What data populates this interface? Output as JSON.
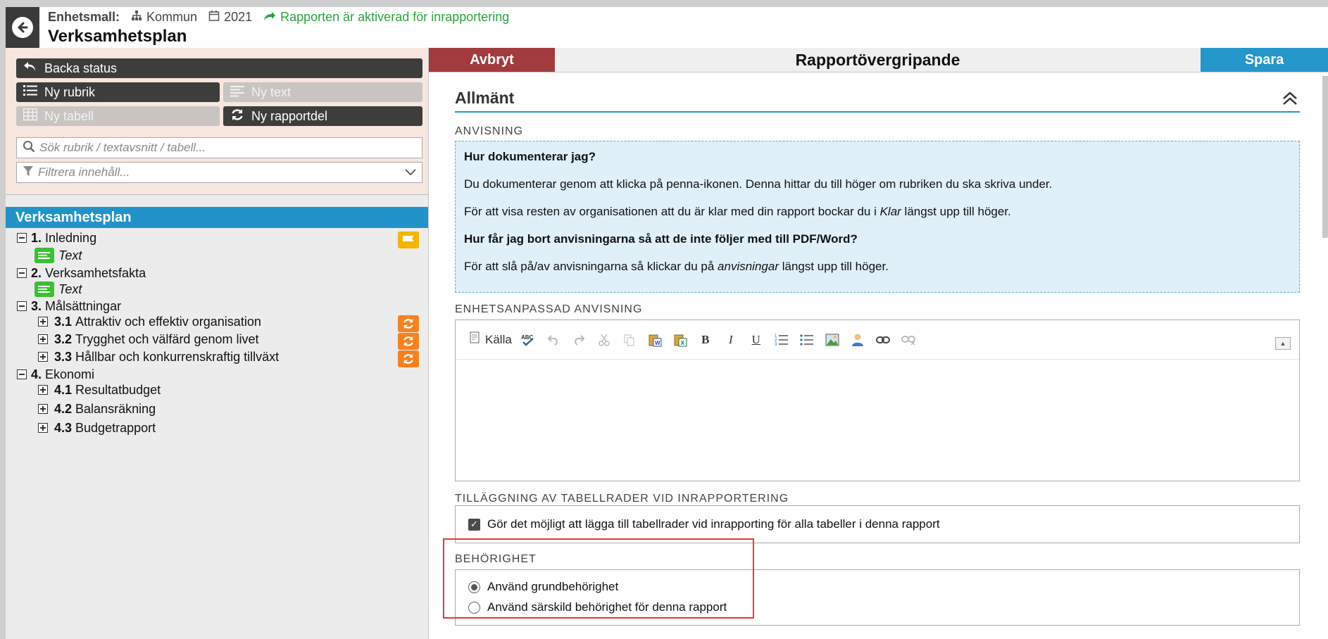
{
  "header": {
    "template_label": "Enhetsmall:",
    "org": "Kommun",
    "year": "2021",
    "status": "Rapporten är aktiverad för inrapportering",
    "title": "Verksamhetsplan"
  },
  "toolbox": {
    "back_status": "Backa status",
    "new_heading": "Ny rubrik",
    "new_text": "Ny text",
    "new_table": "Ny tabell",
    "new_report_part": "Ny rapportdel",
    "search_placeholder": "Sök rubrik / textavsnitt / tabell...",
    "filter_placeholder": "Filtrera innehåll..."
  },
  "tree": {
    "root": "Verksamhetsplan",
    "items": [
      {
        "num": "1.",
        "label": "Inledning"
      },
      {
        "label": "Text"
      },
      {
        "num": "2.",
        "label": "Verksamhetsfakta"
      },
      {
        "label": "Text"
      },
      {
        "num": "3.",
        "label": "Målsättningar"
      },
      {
        "num": "3.1",
        "label": "Attraktiv och effektiv organisation"
      },
      {
        "num": "3.2",
        "label": "Trygghet och välfärd genom livet"
      },
      {
        "num": "3.3",
        "label": "Hållbar och konkurrenskraftig tillväxt"
      },
      {
        "num": "4.",
        "label": "Ekonomi"
      },
      {
        "num": "4.1",
        "label": "Resultatbudget"
      },
      {
        "num": "4.2",
        "label": "Balansräkning"
      },
      {
        "num": "4.3",
        "label": "Budgetrapport"
      }
    ]
  },
  "actions": {
    "cancel": "Avbryt",
    "title": "Rapportövergripande",
    "save": "Spara"
  },
  "section": {
    "title": "Allmänt",
    "anvisning_label": "ANVISNING",
    "q1": "Hur dokumenterar jag?",
    "p1": "Du dokumenterar genom att klicka på penna-ikonen. Denna hittar du till höger om rubriken du ska skriva under.",
    "p2_a": "För att visa resten av organisationen att du är klar med din rapport bockar du i ",
    "p2_em": "Klar",
    "p2_b": " längst upp till höger.",
    "q2": "Hur får jag bort anvisningarna så att de inte följer med till PDF/Word?",
    "p3_a": "För att slå på/av anvisningarna så klickar du på ",
    "p3_em": "anvisningar",
    "p3_b": " längst upp till höger.",
    "custom_label": "ENHETSANPASSAD ANVISNING",
    "source_label": "Källa",
    "table_rows_label": "TILLÄGGNING AV TABELLRADER VID INRAPPORTERING",
    "table_rows_option": "Gör det möjligt att lägga till tabellrader vid inrapporting för alla tabeller i denna rapport",
    "permission_label": "BEHÖRIGHET",
    "perm_default": "Använd grundbehörighet",
    "perm_special": "Använd särskild behörighet för denna rapport"
  },
  "colors": {
    "accent_blue": "#2596ca",
    "cancel_red": "#a23b3d",
    "status_green": "#2aa33d",
    "badge_orange": "#f58220",
    "badge_yellow": "#f5b400",
    "text_icon_green": "#39c130",
    "highlight_red": "#e0393c"
  }
}
